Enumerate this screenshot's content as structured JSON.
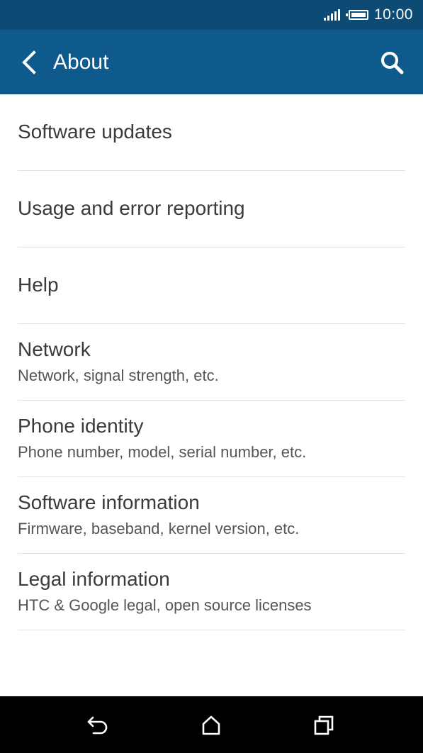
{
  "status_bar": {
    "time": "10:00",
    "icons": [
      "signal-icon",
      "battery-icon"
    ]
  },
  "app_bar": {
    "title": "About",
    "back_icon": "chevron-left-icon",
    "search_icon": "search-icon"
  },
  "colors": {
    "status_bar_bg": "#0d4a74",
    "app_bar_bg": "#0f5a8c",
    "nav_bar_bg": "#000000",
    "title_text": "#3a3a3a",
    "subtitle_text": "#555555",
    "divider": "#e2e2e2"
  },
  "list": {
    "items": [
      {
        "title": "Software updates",
        "subtitle": ""
      },
      {
        "title": "Usage and error reporting",
        "subtitle": ""
      },
      {
        "title": "Help",
        "subtitle": ""
      },
      {
        "title": "Network",
        "subtitle": "Network, signal strength, etc."
      },
      {
        "title": "Phone identity",
        "subtitle": "Phone number, model, serial number, etc."
      },
      {
        "title": "Software information",
        "subtitle": "Firmware, baseband, kernel version, etc."
      },
      {
        "title": "Legal information",
        "subtitle": "HTC & Google legal, open source licenses"
      }
    ]
  },
  "nav_bar": {
    "icons": [
      "back-icon",
      "home-icon",
      "recent-apps-icon"
    ]
  }
}
